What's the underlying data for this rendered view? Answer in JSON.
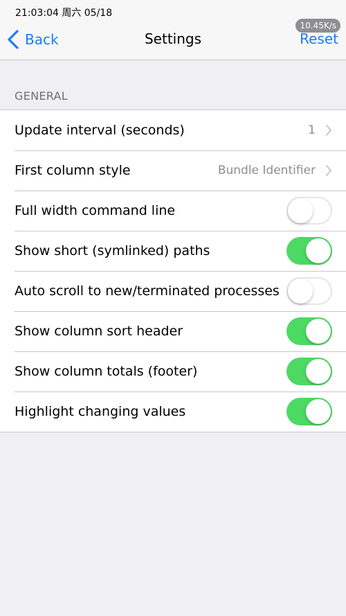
{
  "status_bar": {
    "time": "21:03:04 周六 05/18",
    "net_speed": "10.45K/s"
  },
  "nav": {
    "back_label": "Back",
    "title": "Settings",
    "reset_label": "Reset"
  },
  "section": {
    "header": "GENERAL"
  },
  "rows": [
    {
      "label": "Update interval (seconds)",
      "value": "1",
      "type": "disclosure"
    },
    {
      "label": "First column style",
      "value": "Bundle Identifier",
      "type": "disclosure"
    },
    {
      "label": "Full width command line",
      "type": "toggle",
      "on": false
    },
    {
      "label": "Show short (symlinked) paths",
      "type": "toggle",
      "on": true
    },
    {
      "label": "Auto scroll to new/terminated processes",
      "type": "toggle",
      "on": false
    },
    {
      "label": "Show column sort header",
      "type": "toggle",
      "on": true
    },
    {
      "label": "Show column totals (footer)",
      "type": "toggle",
      "on": true
    },
    {
      "label": "Highlight changing values",
      "type": "toggle",
      "on": true
    }
  ],
  "colors": {
    "accent": "#1a7cf7",
    "toggle_on": "#4cd964",
    "background": "#efeff4"
  }
}
